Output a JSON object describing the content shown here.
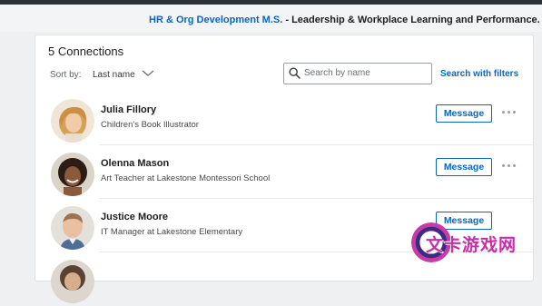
{
  "banner": {
    "link_text": "HR & Org Development M.S.",
    "separator": " - ",
    "text": "Leadership & Workplace Learning and Performance. Appl"
  },
  "connections": {
    "count_label": "5 Connections",
    "sort": {
      "label": "Sort by:",
      "value": "Last name"
    },
    "search": {
      "placeholder": "Search by name",
      "value": "",
      "filters_link": "Search with filters"
    },
    "people": [
      {
        "name": "Julia Fillory",
        "headline": "Children's Book Illustrator",
        "message_label": "Message"
      },
      {
        "name": "Olenna Mason",
        "headline": "Art Teacher at Lakestone Montessori School",
        "message_label": "Message"
      },
      {
        "name": "Justice Moore",
        "headline": "IT Manager at Lakestone Elementary",
        "message_label": "Message"
      }
    ]
  },
  "watermark": {
    "text": "文卡游戏网"
  },
  "colors": {
    "accent": "#0a66c2",
    "topbar": "#2d3135",
    "background": "#eef0f2"
  },
  "icons": {
    "search": "search-icon",
    "sort": "chevron-down-icon",
    "more": "more-options-icon"
  }
}
